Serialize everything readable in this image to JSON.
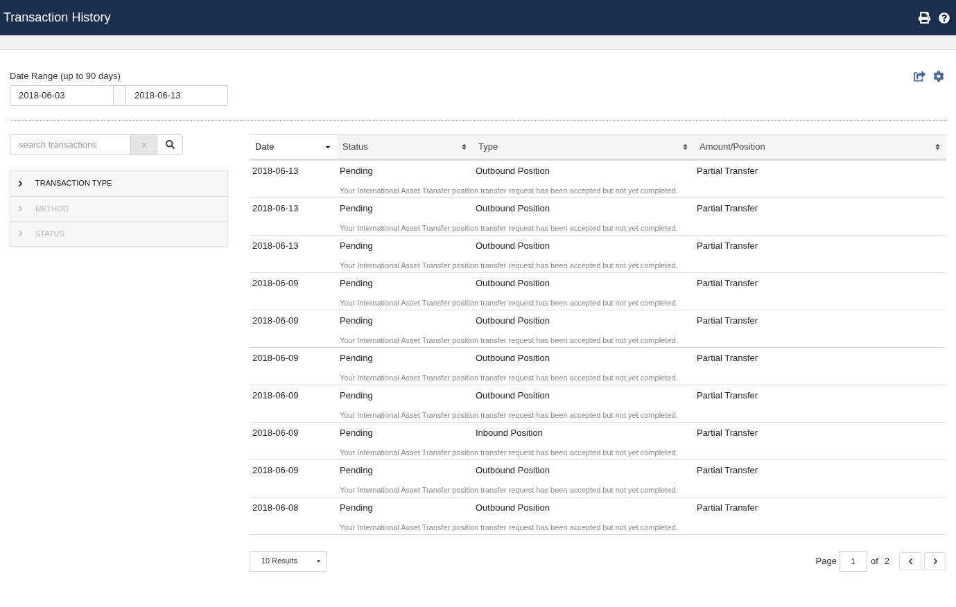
{
  "header": {
    "title": "Transaction History"
  },
  "date_range": {
    "label": "Date Range (up to 90 days)",
    "start": "2018-06-03",
    "end": "2018-06-13"
  },
  "search": {
    "placeholder": "search transactions"
  },
  "filters": [
    {
      "label": "TRANSACTION TYPE",
      "disabled": false
    },
    {
      "label": "METHOD",
      "disabled": true
    },
    {
      "label": "STATUS",
      "disabled": true
    }
  ],
  "table": {
    "columns": [
      {
        "label": "Date",
        "selected": true
      },
      {
        "label": "Status",
        "selected": false
      },
      {
        "label": "Type",
        "selected": false
      },
      {
        "label": "Amount/Position",
        "selected": false
      }
    ],
    "rows": [
      {
        "date": "2018-06-13",
        "status": "Pending",
        "type": "Outbound Position",
        "amount": "Partial Transfer",
        "note": "Your International Asset Transfer position transfer request has been accepted but not yet completed."
      },
      {
        "date": "2018-06-13",
        "status": "Pending",
        "type": "Outbound Position",
        "amount": "Partial Transfer",
        "note": "Your International Asset Transfer position transfer request has been accepted but not yet completed."
      },
      {
        "date": "2018-06-13",
        "status": "Pending",
        "type": "Outbound Position",
        "amount": "Partial Transfer",
        "note": "Your International Asset Transfer position transfer request has been accepted but not yet completed."
      },
      {
        "date": "2018-06-09",
        "status": "Pending",
        "type": "Outbound Position",
        "amount": "Partial Transfer",
        "note": "Your International Asset Transfer position transfer request has been accepted but not yet completed."
      },
      {
        "date": "2018-06-09",
        "status": "Pending",
        "type": "Outbound Position",
        "amount": "Partial Transfer",
        "note": "Your International Asset Transfer position transfer request has been accepted but not yet completed."
      },
      {
        "date": "2018-06-09",
        "status": "Pending",
        "type": "Outbound Position",
        "amount": "Partial Transfer",
        "note": "Your International Asset Transfer position transfer request has been accepted but not yet completed."
      },
      {
        "date": "2018-06-09",
        "status": "Pending",
        "type": "Outbound Position",
        "amount": "Partial Transfer",
        "note": "Your International Asset Transfer position transfer request has been accepted but not yet completed."
      },
      {
        "date": "2018-06-09",
        "status": "Pending",
        "type": "Inbound Position",
        "amount": "Partial Transfer",
        "note": "Your International Asset Transfer position transfer request has been accepted but not yet completed."
      },
      {
        "date": "2018-06-09",
        "status": "Pending",
        "type": "Outbound Position",
        "amount": "Partial Transfer",
        "note": "Your International Asset Transfer position transfer request has been accepted but not yet completed."
      },
      {
        "date": "2018-06-08",
        "status": "Pending",
        "type": "Outbound Position",
        "amount": "Partial Transfer",
        "note": "Your International Asset Transfer position transfer request has been accepted but not yet completed."
      }
    ]
  },
  "pagination": {
    "page_size": "10 Results",
    "page_label": "Page",
    "page": "1",
    "of_label": "of",
    "total": "2"
  }
}
